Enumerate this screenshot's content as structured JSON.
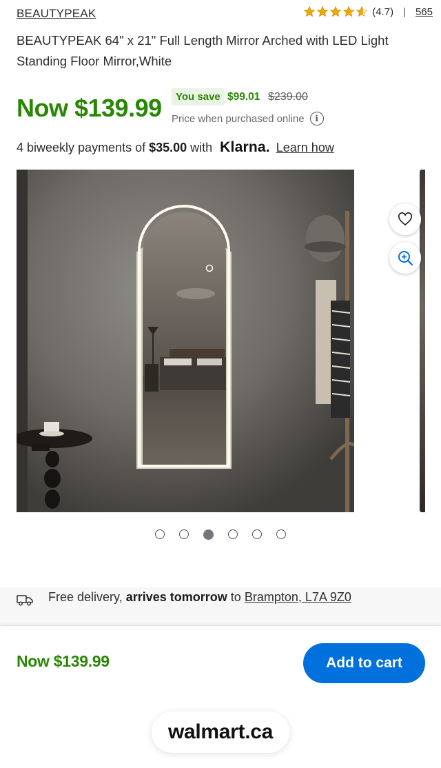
{
  "header": {
    "brand": "BEAUTYPEAK",
    "rating": {
      "stars_filled": 4.7,
      "score_text": "(4.7)",
      "separator": "|",
      "review_count": "565",
      "star_color": "#f2a600"
    }
  },
  "product": {
    "title": "BEAUTYPEAK 64\" x 21\" Full Length Mirror Arched with LED Light Standing Floor Mirror,White"
  },
  "pricing": {
    "now_price": "Now $139.99",
    "you_save_label": "You save",
    "save_amount": "$99.01",
    "was_price": "$239.00",
    "price_note": "Price when purchased online",
    "accent_color": "#2a8703"
  },
  "payments": {
    "prefix": "4 biweekly payments of",
    "amount": "$35.00",
    "with": "with",
    "provider": "Klarna.",
    "learn_link": "Learn how"
  },
  "gallery": {
    "image_alt": "Arched LED full length mirror leaning against a wall",
    "slide_count": 6,
    "active_slide": 3,
    "icons": {
      "favorite": "heart-icon",
      "zoom": "zoom-in-icon"
    }
  },
  "delivery": {
    "icon": "truck-icon",
    "text_prefix": "Free delivery,",
    "highlight": "arrives tomorrow",
    "to": "to",
    "location": "Brampton, L7A 9Z0"
  },
  "bottom_bar": {
    "price": "Now $139.99",
    "add_to_cart": "Add to cart",
    "button_color": "#0071dc",
    "site_label": "walmart.ca"
  }
}
